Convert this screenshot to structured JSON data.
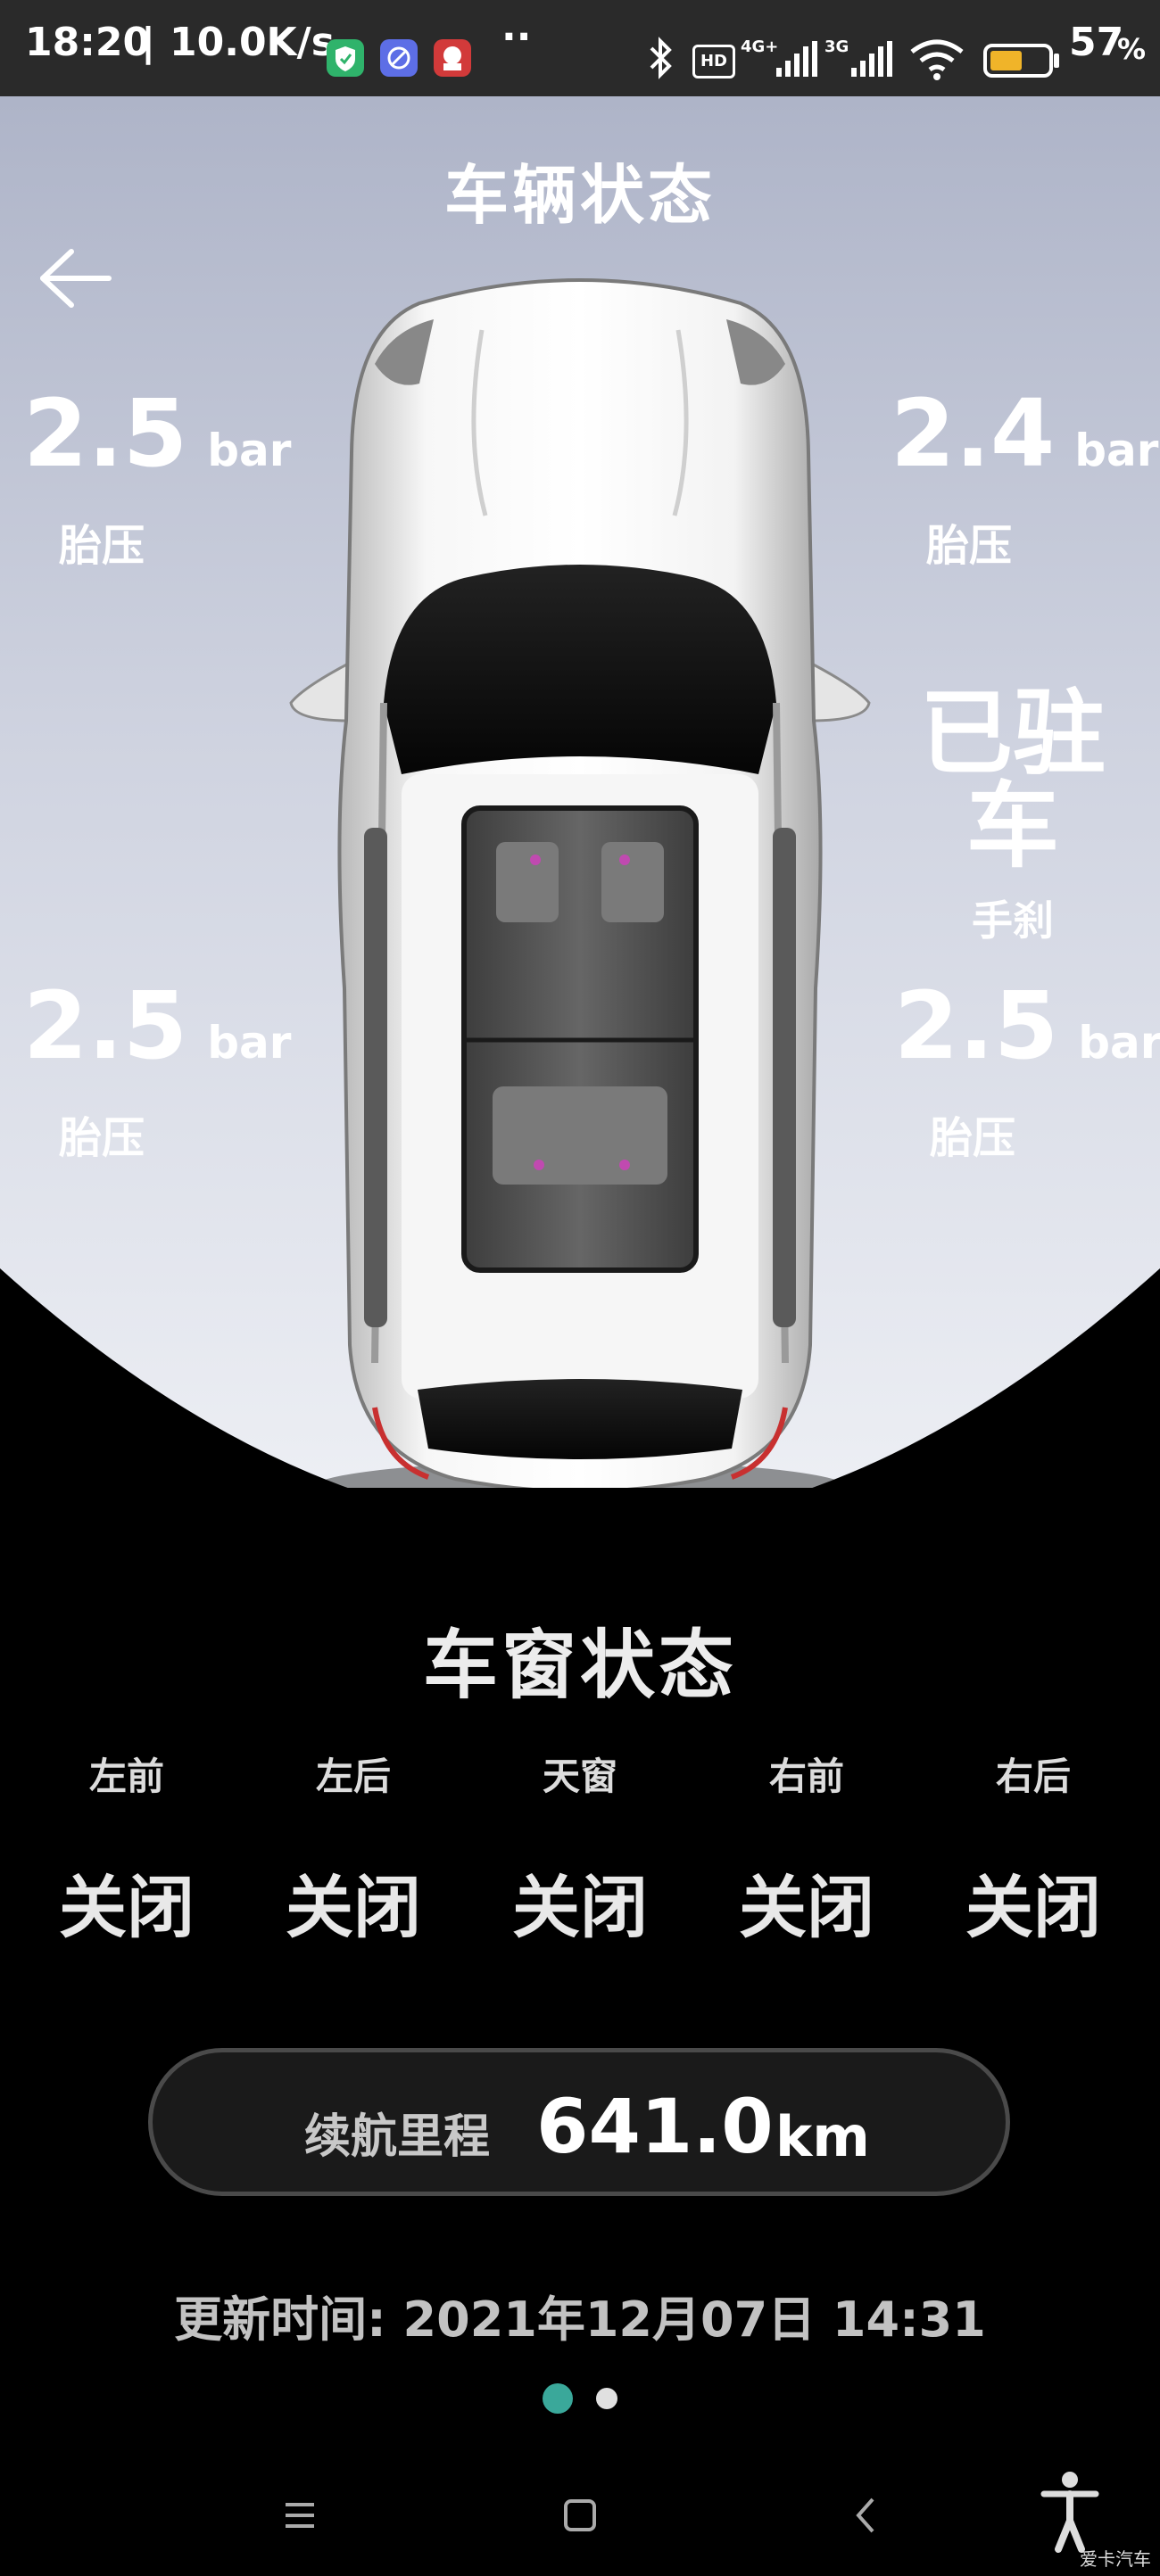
{
  "status_bar": {
    "time": "18:20",
    "speed": "10.0K/s",
    "battery": "57",
    "battery_pct": "%",
    "battery_level": 0.57,
    "hd": "HD",
    "net1": "4G+",
    "net2": "3G"
  },
  "header": {
    "title": "车辆状态"
  },
  "tires": {
    "front_left": {
      "value": "2.5",
      "unit": "bar",
      "label": "胎压"
    },
    "front_right": {
      "value": "2.4",
      "unit": "bar",
      "label": "胎压"
    },
    "rear_left": {
      "value": "2.5",
      "unit": "bar",
      "label": "胎压"
    },
    "rear_right": {
      "value": "2.5",
      "unit": "bar",
      "label": "胎压"
    }
  },
  "parking": {
    "status": "已驻车",
    "label": "手刹"
  },
  "windows": {
    "title": "车窗状态",
    "items": [
      {
        "label": "左前",
        "status": "关闭"
      },
      {
        "label": "左后",
        "status": "关闭"
      },
      {
        "label": "天窗",
        "status": "关闭"
      },
      {
        "label": "右前",
        "status": "关闭"
      },
      {
        "label": "右后",
        "status": "关闭"
      }
    ]
  },
  "range": {
    "label": "续航里程",
    "value": "641.0",
    "unit": "km"
  },
  "update": {
    "text": "更新时间: 2021年12月07日 14:31"
  },
  "pager": {
    "count": 2,
    "active": 0
  },
  "watermark": {
    "text": "爱卡汽车"
  },
  "colors": {
    "accent": "#3aa89a",
    "background": "#000000",
    "sky_top": "#aeb4c8",
    "sky_bottom": "#eef0f5",
    "status_bar": "#2a2a2a"
  }
}
